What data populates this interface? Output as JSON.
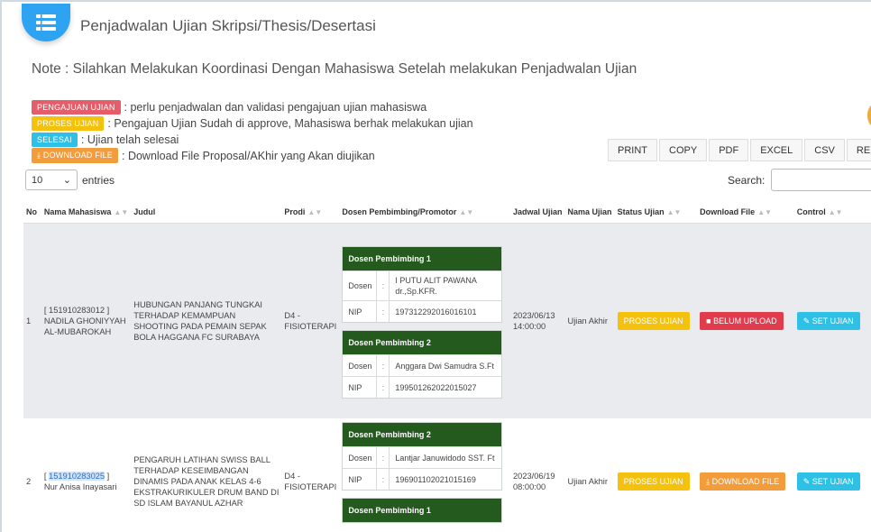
{
  "header": {
    "title": "Penjadwalan Ujian Skripsi/Thesis/Desertasi",
    "icon": "list-icon"
  },
  "note": "Note : Silahkan Melakukan Koordinasi Dengan Mahasiswa Setelah melakukan Penjadwalan Ujian",
  "legend": [
    {
      "badge": "PENGAJUAN UJIAN",
      "text": ": perlu penjadwalan dan validasi pengajuan ujian mahasiswa",
      "color": "#e35d6a"
    },
    {
      "badge": "PROSES UJIAN",
      "text": ": Pengajuan Ujian Sudah di approve, Mahasiswa berhak melakukan ujian",
      "color": "#f4c20d"
    },
    {
      "badge": "SELESAI",
      "text": ": Ujian telah selesai",
      "color": "#2fc0e6"
    },
    {
      "badge": "DOWNLOAD FILE",
      "text": ": Download File Proposal/AKhir yang Akan diujikan",
      "color": "#f39c3c"
    }
  ],
  "export_buttons": [
    "PRINT",
    "COPY",
    "PDF",
    "EXCEL",
    "CSV",
    "RELOAD"
  ],
  "length": {
    "value": "10",
    "label": "entries"
  },
  "search": {
    "label": "Search:",
    "value": ""
  },
  "columns": [
    "No",
    "Nama Mahasiswa",
    "Judul",
    "Prodi",
    "Dosen Pembimbing/Promotor",
    "Jadwal Ujian",
    "Nama Ujian",
    "Status Ujian",
    "Download File",
    "Control"
  ],
  "rows": [
    {
      "no": "1",
      "nim": "[ 151910283012 ]",
      "nama": "NADILA GHONIYYAH AL-MUBAROKAH",
      "judul": "HUBUNGAN PANJANG TUNGKAI TERHADAP KEMAMPUAN SHOOTING PADA PEMAIN SEPAK BOLA HAGGANA FC SURABAYA",
      "prodi": "D4 - FISIOTERAPI",
      "dosen": [
        {
          "title": "Dosen Pembimbing 1",
          "dosen_label": "Dosen",
          "dosen": "I PUTU ALIT PAWANA dr.,Sp.KFR.",
          "nip_label": "NIP",
          "nip": "197312292016016101"
        },
        {
          "title": "Dosen Pembimbing 2",
          "dosen_label": "Dosen",
          "dosen": "Anggara Dwi Samudra S.Ft",
          "nip_label": "NIP",
          "nip": "199501262022015027"
        }
      ],
      "jadwal": "2023/06/13 14:00:00",
      "nama_ujian": "Ujian Akhir",
      "status": "PROSES UJIAN",
      "download": "BELUM UPLOAD",
      "control": "SET UJIAN"
    },
    {
      "no": "2",
      "nim_prefix": "[ ",
      "nim_num": "151910283025",
      "nim_suffix": " ]",
      "nama": "Nur Anisa Inayasari",
      "judul": "PENGARUH LATIHAN SWISS BALL TERHADAP KESEIMBANGAN DINAMIS PADA ANAK KELAS 4-6 EKSTRAKURIKULER DRUM BAND DI SD ISLAM BAYANUL AZHAR",
      "prodi": "D4 - FISIOTERAPI",
      "dosen": [
        {
          "title": "Dosen Pembimbing 2",
          "dosen_label": "Dosen",
          "dosen": "Lantjar Januwidodo SST. Ft",
          "nip_label": "NIP",
          "nip": "196901102021015169"
        },
        {
          "title": "Dosen Pembimbing 1"
        }
      ],
      "jadwal": "2023/06/19 08:00:00",
      "nama_ujian": "Ujian Akhir",
      "status": "PROSES UJIAN",
      "download": "DOWNLOAD FILE",
      "control": "SET UJIAN"
    }
  ]
}
